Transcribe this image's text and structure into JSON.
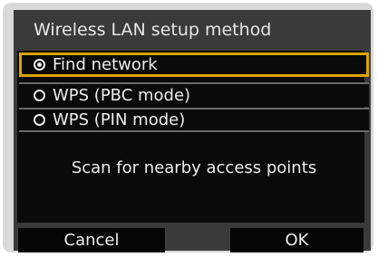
{
  "dialog": {
    "title": "Wireless LAN setup method",
    "options": [
      {
        "label": "Find network",
        "selected": true
      },
      {
        "label": "WPS (PBC mode)",
        "selected": false
      },
      {
        "label": "WPS (PIN mode)",
        "selected": false
      }
    ],
    "description": "Scan for nearby access points",
    "buttons": {
      "cancel": "Cancel",
      "ok": "OK"
    },
    "colors": {
      "highlight": "#d9a400",
      "background": "#3a3a3a",
      "panel": "#0a0a0a"
    }
  }
}
